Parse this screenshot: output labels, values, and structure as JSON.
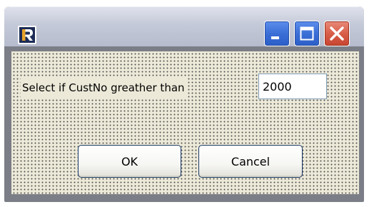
{
  "window": {
    "icon": "fastreport-logo-icon",
    "controls": {
      "minimize": "minimize-icon",
      "maximize": "maximize-icon",
      "close": "close-icon"
    }
  },
  "dialog": {
    "prompt_label": "Select if CustNo greather than",
    "input_value": "2000",
    "ok_label": "OK",
    "cancel_label": "Cancel"
  },
  "colors": {
    "titlebar": "#c4c9d8",
    "frame": "#7b7e86",
    "client_background": "#ece9d8",
    "control_blue": "#3b6fd6",
    "close_red": "#d85e48"
  }
}
